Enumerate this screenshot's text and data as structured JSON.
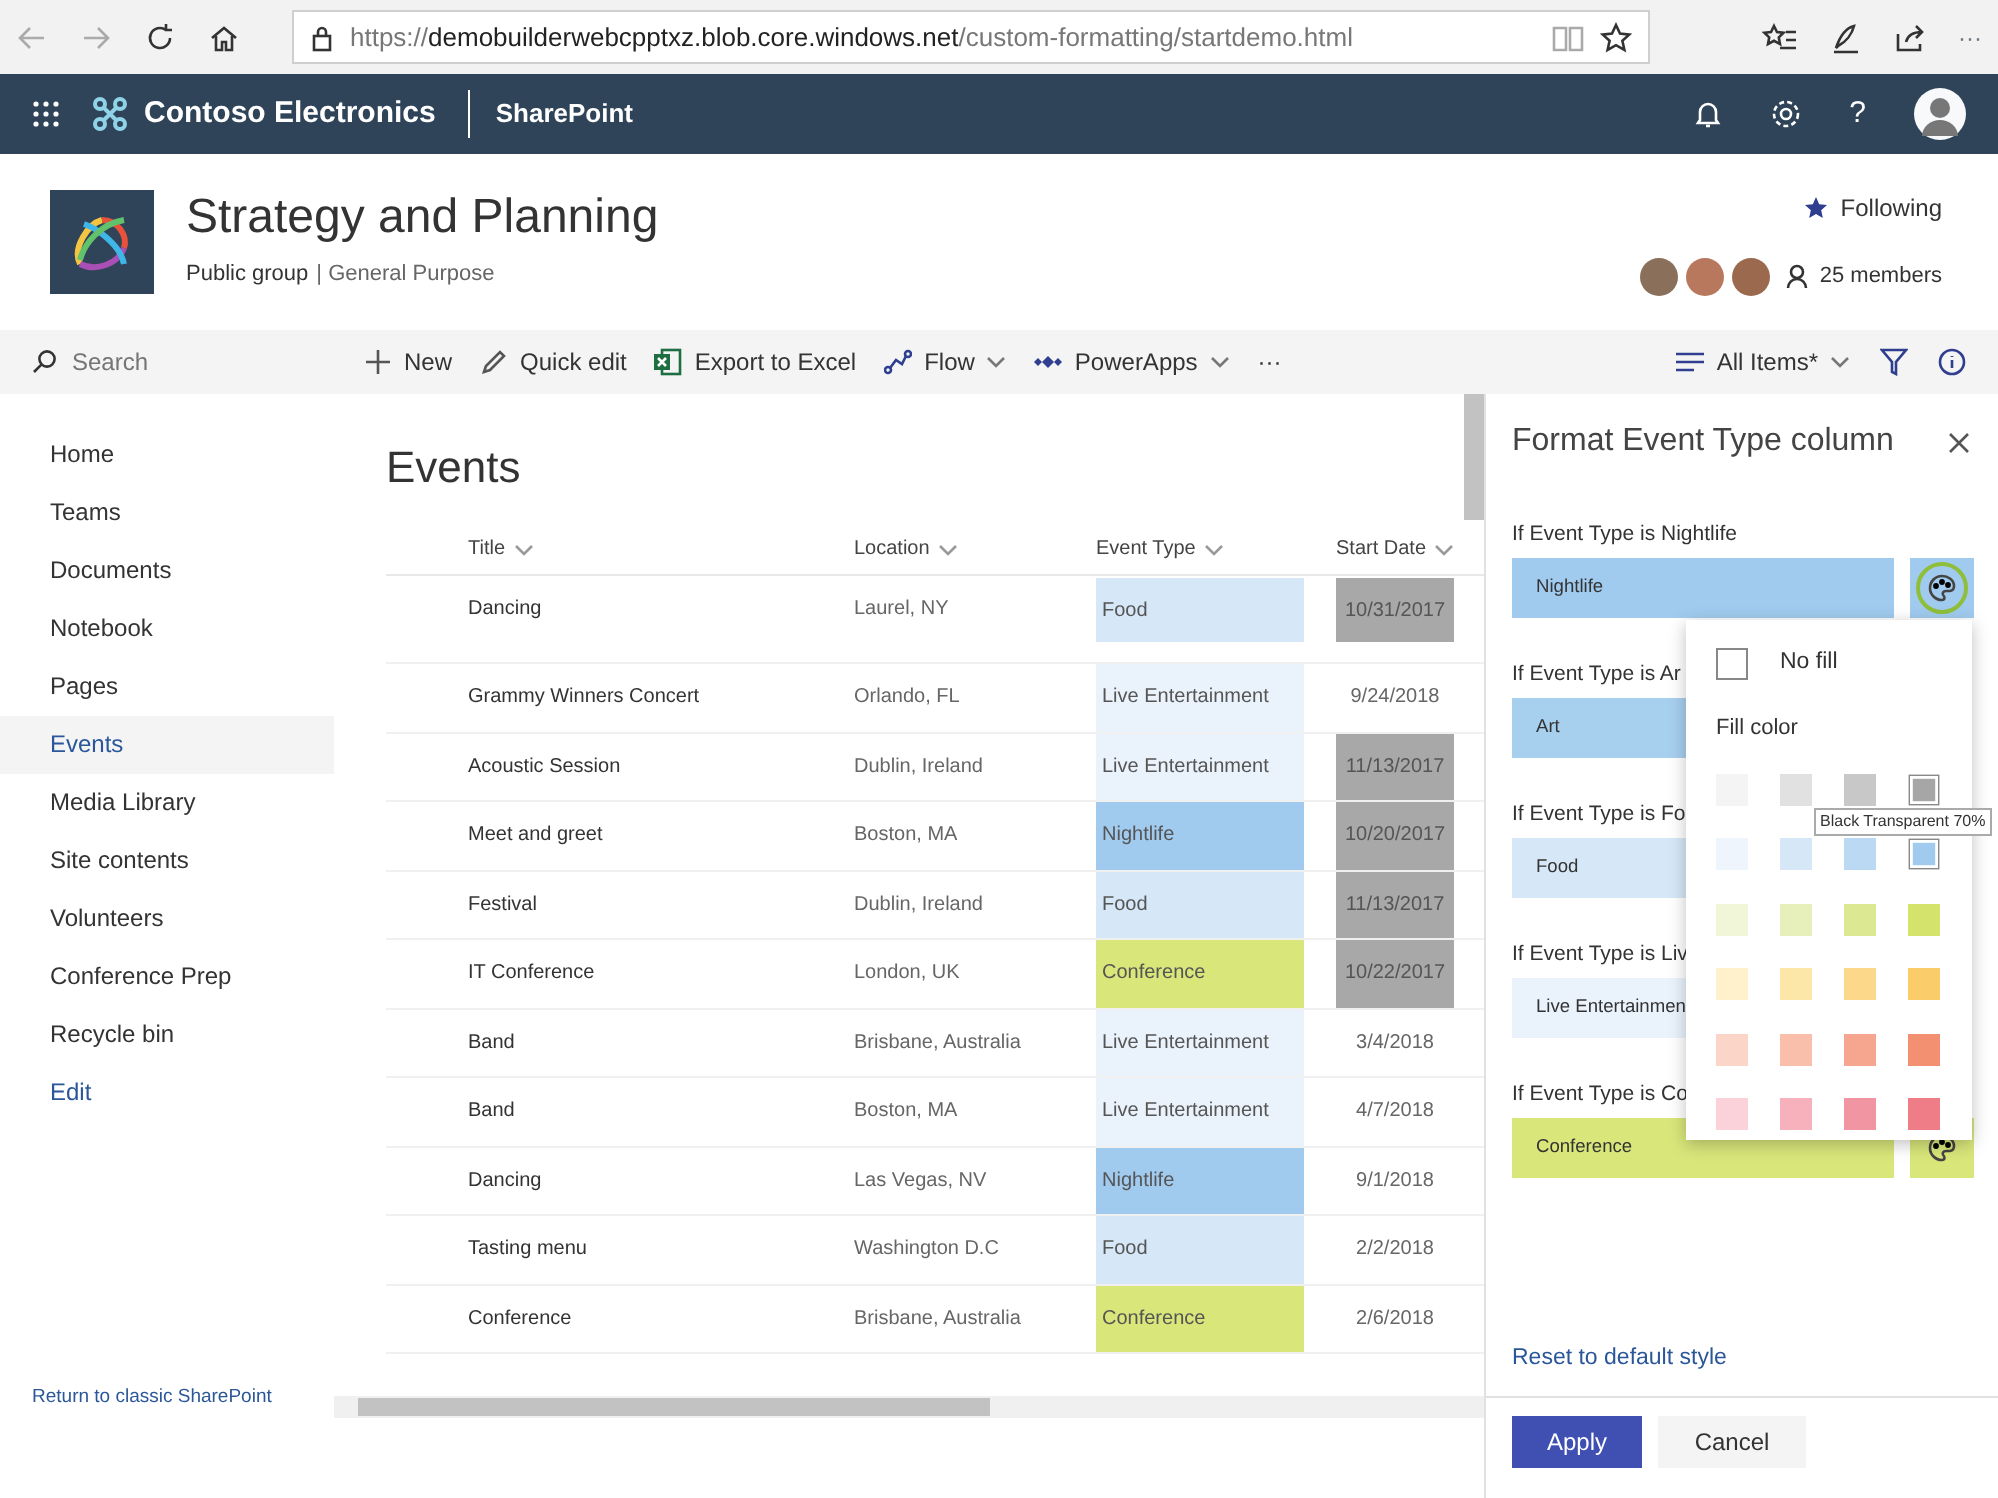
{
  "browser": {
    "url_scheme": "https://",
    "url_host": "demobuilderwebcpptxz.blob.core.windows.net",
    "url_path": "/custom-formatting/startdemo.html",
    "more": "···"
  },
  "suite_bar": {
    "brand": "Contoso Electronics",
    "app": "SharePoint",
    "help": "?"
  },
  "site": {
    "title": "Strategy and Planning",
    "group": "Public group",
    "classification": "| General Purpose",
    "following": "Following",
    "members": "25 members"
  },
  "search": {
    "placeholder": "Search"
  },
  "commands": [
    {
      "label": "New",
      "dropdown": false
    },
    {
      "label": "Quick edit",
      "dropdown": false
    },
    {
      "label": "Export to Excel",
      "dropdown": false
    },
    {
      "label": "Flow",
      "dropdown": true
    },
    {
      "label": "PowerApps",
      "dropdown": true
    },
    {
      "label": "···",
      "dropdown": false
    }
  ],
  "view": {
    "label": "All Items*"
  },
  "nav": [
    {
      "label": "Home",
      "selected": false
    },
    {
      "label": "Teams",
      "selected": false
    },
    {
      "label": "Documents",
      "selected": false
    },
    {
      "label": "Notebook",
      "selected": false
    },
    {
      "label": "Pages",
      "selected": false
    },
    {
      "label": "Events",
      "selected": true
    },
    {
      "label": "Media Library",
      "selected": false
    },
    {
      "label": "Site contents",
      "selected": false
    },
    {
      "label": "Volunteers",
      "selected": false
    },
    {
      "label": "Conference Prep",
      "selected": false
    },
    {
      "label": "Recycle bin",
      "selected": false
    }
  ],
  "edit_link": "Edit",
  "classic_link": "Return to classic SharePoint",
  "list": {
    "title": "Events",
    "columns": [
      "Title",
      "Location",
      "Event Type",
      "Start Date"
    ],
    "rows": [
      {
        "title": "Dancing",
        "location": "Laurel, NY",
        "event_type": "Food",
        "color": "#d6e8f7",
        "start_date": "10/31/2017",
        "past": true
      },
      {
        "title": "Grammy Winners Concert",
        "location": "Orlando, FL",
        "event_type": "Live Entertainment",
        "color": "#eaf3fc",
        "start_date": "9/24/2018",
        "past": false
      },
      {
        "title": "Acoustic Session",
        "location": "Dublin, Ireland",
        "event_type": "Live Entertainment",
        "color": "#eaf3fc",
        "start_date": "11/13/2017",
        "past": true
      },
      {
        "title": "Meet and greet",
        "location": "Boston, MA",
        "event_type": "Nightlife",
        "color": "#a0cbee",
        "start_date": "10/20/2017",
        "past": true
      },
      {
        "title": "Festival",
        "location": "Dublin, Ireland",
        "event_type": "Food",
        "color": "#d6e8f7",
        "start_date": "11/13/2017",
        "past": true
      },
      {
        "title": "IT Conference",
        "location": "London, UK",
        "event_type": "Conference",
        "color": "#d8e67a",
        "start_date": "10/22/2017",
        "past": true
      },
      {
        "title": "Band",
        "location": "Brisbane, Australia",
        "event_type": "Live Entertainment",
        "color": "#eaf3fc",
        "start_date": "3/4/2018",
        "past": false
      },
      {
        "title": "Band",
        "location": "Boston, MA",
        "event_type": "Live Entertainment",
        "color": "#eaf3fc",
        "start_date": "4/7/2018",
        "past": false
      },
      {
        "title": "Dancing",
        "location": "Las Vegas, NV",
        "event_type": "Nightlife",
        "color": "#a0cbee",
        "start_date": "9/1/2018",
        "past": false
      },
      {
        "title": "Tasting menu",
        "location": "Washington D.C",
        "event_type": "Food",
        "color": "#d6e8f7",
        "start_date": "2/2/2018",
        "past": false
      },
      {
        "title": "Conference",
        "location": "Brisbane, Australia",
        "event_type": "Conference",
        "color": "#d8e67a",
        "start_date": "2/6/2018",
        "past": false
      }
    ]
  },
  "panel": {
    "title": "Format Event Type column",
    "rules": [
      {
        "label": "If Event Type is Nightlife",
        "value": "Nightlife",
        "color": "#a0cbee",
        "palette": {
          "focused": true
        }
      },
      {
        "label": "If Event Type is Ar",
        "value": "Art",
        "color": "#a7cfee"
      },
      {
        "label": "If Event Type is Fo",
        "value": "Food",
        "color": "#d6e8f7"
      },
      {
        "label": "If Event Type is Liv",
        "value": "Live Entertainmen",
        "color": "#eaf3fc"
      },
      {
        "label": "If Event Type is Co",
        "value": "Conference",
        "color": "#d8e67a",
        "palette": {
          "focused": false
        }
      }
    ],
    "reset": "Reset to default style",
    "apply": "Apply",
    "cancel": "Cancel"
  },
  "color_picker": {
    "no_fill": "No fill",
    "no_fill_checked": false,
    "heading": "Fill color",
    "tooltip": "Black Transparent 70%",
    "swatches": [
      {
        "color": "#f4f4f4",
        "outlined": false
      },
      {
        "color": "#e1e1e1",
        "outlined": false
      },
      {
        "color": "#c8c8c8",
        "outlined": false
      },
      {
        "color": "#a6a6a6",
        "outlined": true
      },
      {
        "color": "#eef5fd",
        "outlined": false
      },
      {
        "color": "#d6e8f7",
        "outlined": false
      },
      {
        "color": "#bcd9f3",
        "outlined": false
      },
      {
        "color": "#a0cbee",
        "outlined": true
      },
      {
        "color": "#f1f6d8",
        "outlined": false
      },
      {
        "color": "#e7efbb",
        "outlined": false
      },
      {
        "color": "#dde893",
        "outlined": false
      },
      {
        "color": "#d4e36c",
        "outlined": false
      },
      {
        "color": "#fff1cc",
        "outlined": false
      },
      {
        "color": "#fde7a8",
        "outlined": false
      },
      {
        "color": "#fcd98a",
        "outlined": false
      },
      {
        "color": "#fbcc6a",
        "outlined": false
      },
      {
        "color": "#fcd5c9",
        "outlined": false
      },
      {
        "color": "#f9bfab",
        "outlined": false
      },
      {
        "color": "#f6a68e",
        "outlined": false
      },
      {
        "color": "#f39072",
        "outlined": false
      },
      {
        "color": "#fbd2d9",
        "outlined": false
      },
      {
        "color": "#f6b1bd",
        "outlined": false
      },
      {
        "color": "#f295a2",
        "outlined": false
      },
      {
        "color": "#ee7d88",
        "outlined": false
      }
    ]
  }
}
